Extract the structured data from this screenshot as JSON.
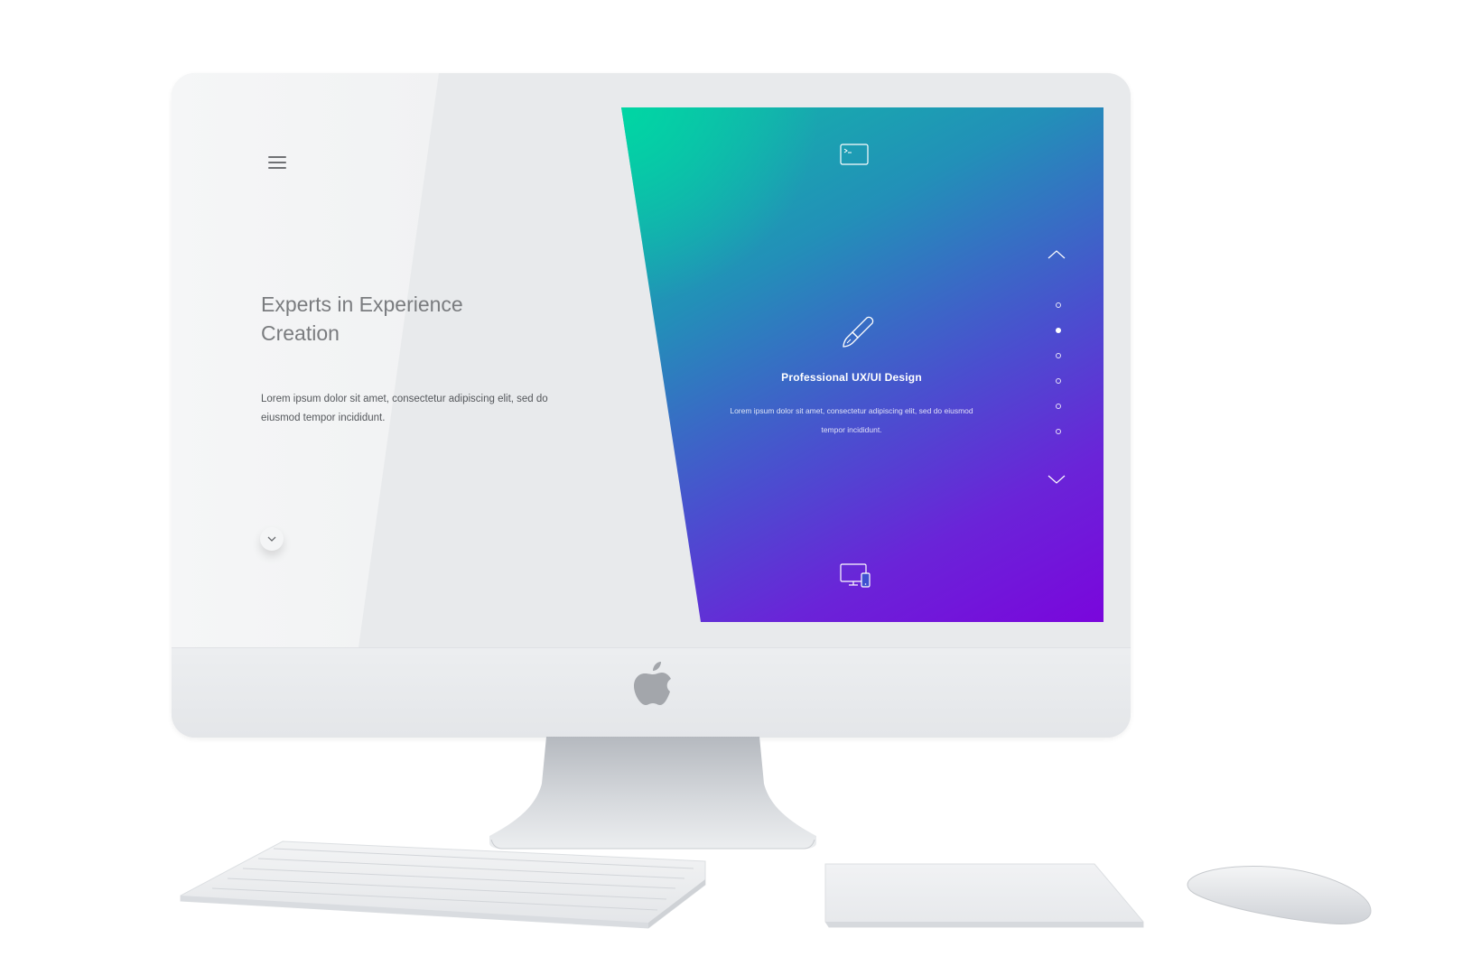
{
  "screen": {
    "left_panel": {
      "headline": "Experts in Experience\nCreation",
      "body": "Lorem ipsum dolor sit amet, consectetur adipiscing elit, sed do eiusmod tempor incididunt."
    },
    "right_panel": {
      "title": "Professional UX/UI Design",
      "body": "Lorem ipsum dolor sit amet, consectetur adipiscing elit, sed do eiusmod tempor incididunt.",
      "gradient": {
        "start": "#00d6a4",
        "mid": "#4a4fcf",
        "end": "#7a06dc"
      },
      "pagination": {
        "total": 6,
        "active_index": 1
      }
    },
    "icons": {
      "menu": "hamburger-menu-icon",
      "top": "terminal-icon",
      "center": "pen-brush-icon",
      "bottom": "devices-icon",
      "up": "chevron-up-icon",
      "down": "chevron-down-icon",
      "scroll": "chevron-down-small-icon"
    }
  },
  "hardware": {
    "logo": "apple-logo",
    "peripherals": [
      "keyboard",
      "trackpad",
      "mouse"
    ]
  }
}
